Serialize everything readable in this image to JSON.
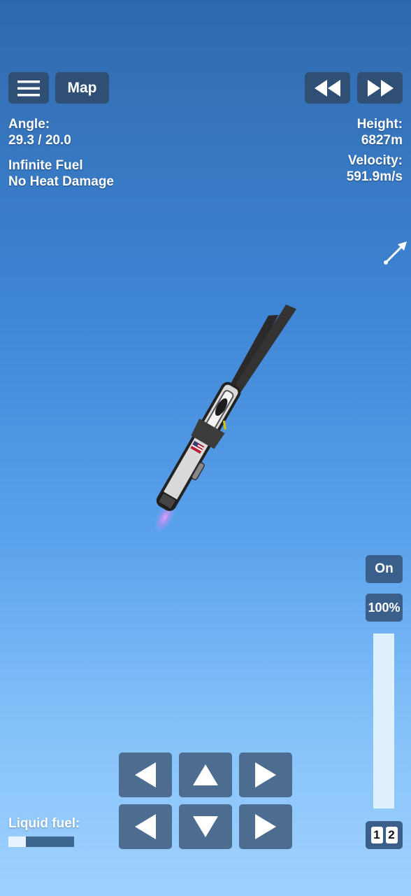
{
  "top_bar": {
    "menu_icon": "hamburger-menu-icon",
    "map_label": "Map",
    "rewind_icon": "rewind-icon",
    "fast_forward_icon": "fast-forward-icon"
  },
  "flight_info": {
    "angle_label": "Angle:",
    "angle_value": "29.3 / 20.0",
    "infinite_fuel": "Infinite Fuel",
    "no_heat_damage": "No Heat Damage",
    "height_label": "Height:",
    "height_value": "6827m",
    "velocity_label": "Velocity:",
    "velocity_value": "591.9m/s"
  },
  "direction_indicator_icon": "velocity-arrow-icon",
  "throttle": {
    "engine_toggle_label": "On",
    "percent_label": "100%",
    "level": 1.0
  },
  "stage_buttons": [
    "1",
    "2"
  ],
  "fuel": {
    "label": "Liquid fuel:",
    "level": 0.27
  },
  "controls": {
    "top_row": [
      "rotate-left-icon",
      "thrust-up-icon",
      "rotate-right-icon"
    ],
    "bottom_row": [
      "move-left-icon",
      "thrust-down-icon",
      "move-right-icon"
    ]
  },
  "colors": {
    "button_dark": "#2f4f74",
    "control_button": "#4c6c90",
    "sky_top": "#2f69ad",
    "sky_bottom": "#9fd1fd",
    "throttle_bar": "#dff0ff",
    "fuel_fill": "#e9f3ff",
    "fuel_empty": "#3d6690"
  }
}
